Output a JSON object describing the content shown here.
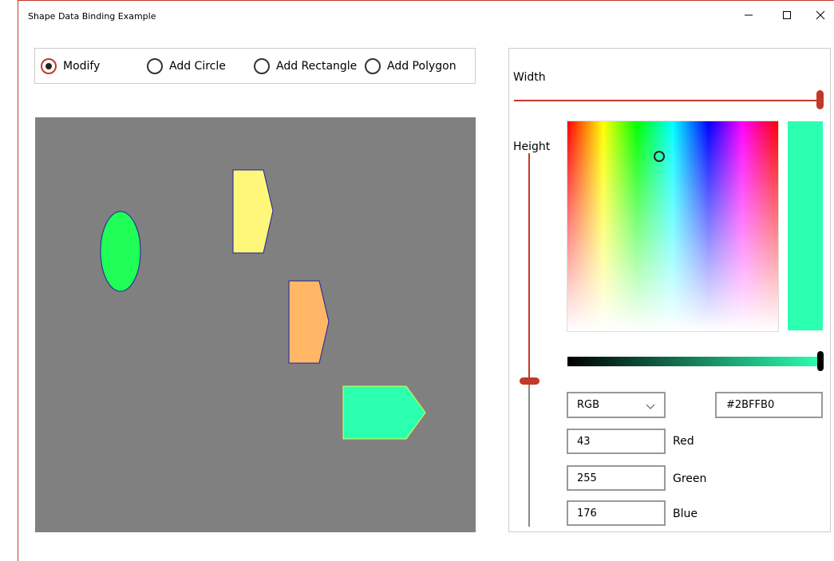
{
  "window": {
    "title": "Shape Data Binding Example"
  },
  "modes": [
    {
      "label": "Modify",
      "checked": true
    },
    {
      "label": "Add Circle",
      "checked": false
    },
    {
      "label": "Add Rectangle",
      "checked": false
    },
    {
      "label": "Add Polygon",
      "checked": false
    }
  ],
  "canvas": {
    "background": "#808080",
    "shapes": [
      {
        "type": "ellipse",
        "fill": "#1FFF58",
        "stroke": "#2020A0"
      },
      {
        "type": "polygon",
        "fill": "#FFF77A",
        "stroke": "#2020A0"
      },
      {
        "type": "polygon",
        "fill": "#FFB766",
        "stroke": "#2020A0"
      },
      {
        "type": "polygon",
        "fill": "#2BFFB0",
        "stroke": "#E8FF40"
      }
    ]
  },
  "panel": {
    "width_label": "Width",
    "width_value": 1.0,
    "height_label": "Height",
    "height_value": 0.39
  },
  "picker": {
    "mode": "RGB",
    "hex": "#2BFFB0",
    "red": "43",
    "green": "255",
    "blue": "176",
    "red_label": "Red",
    "green_label": "Green",
    "blue_label": "Blue",
    "accent_color": "#C0392B"
  }
}
